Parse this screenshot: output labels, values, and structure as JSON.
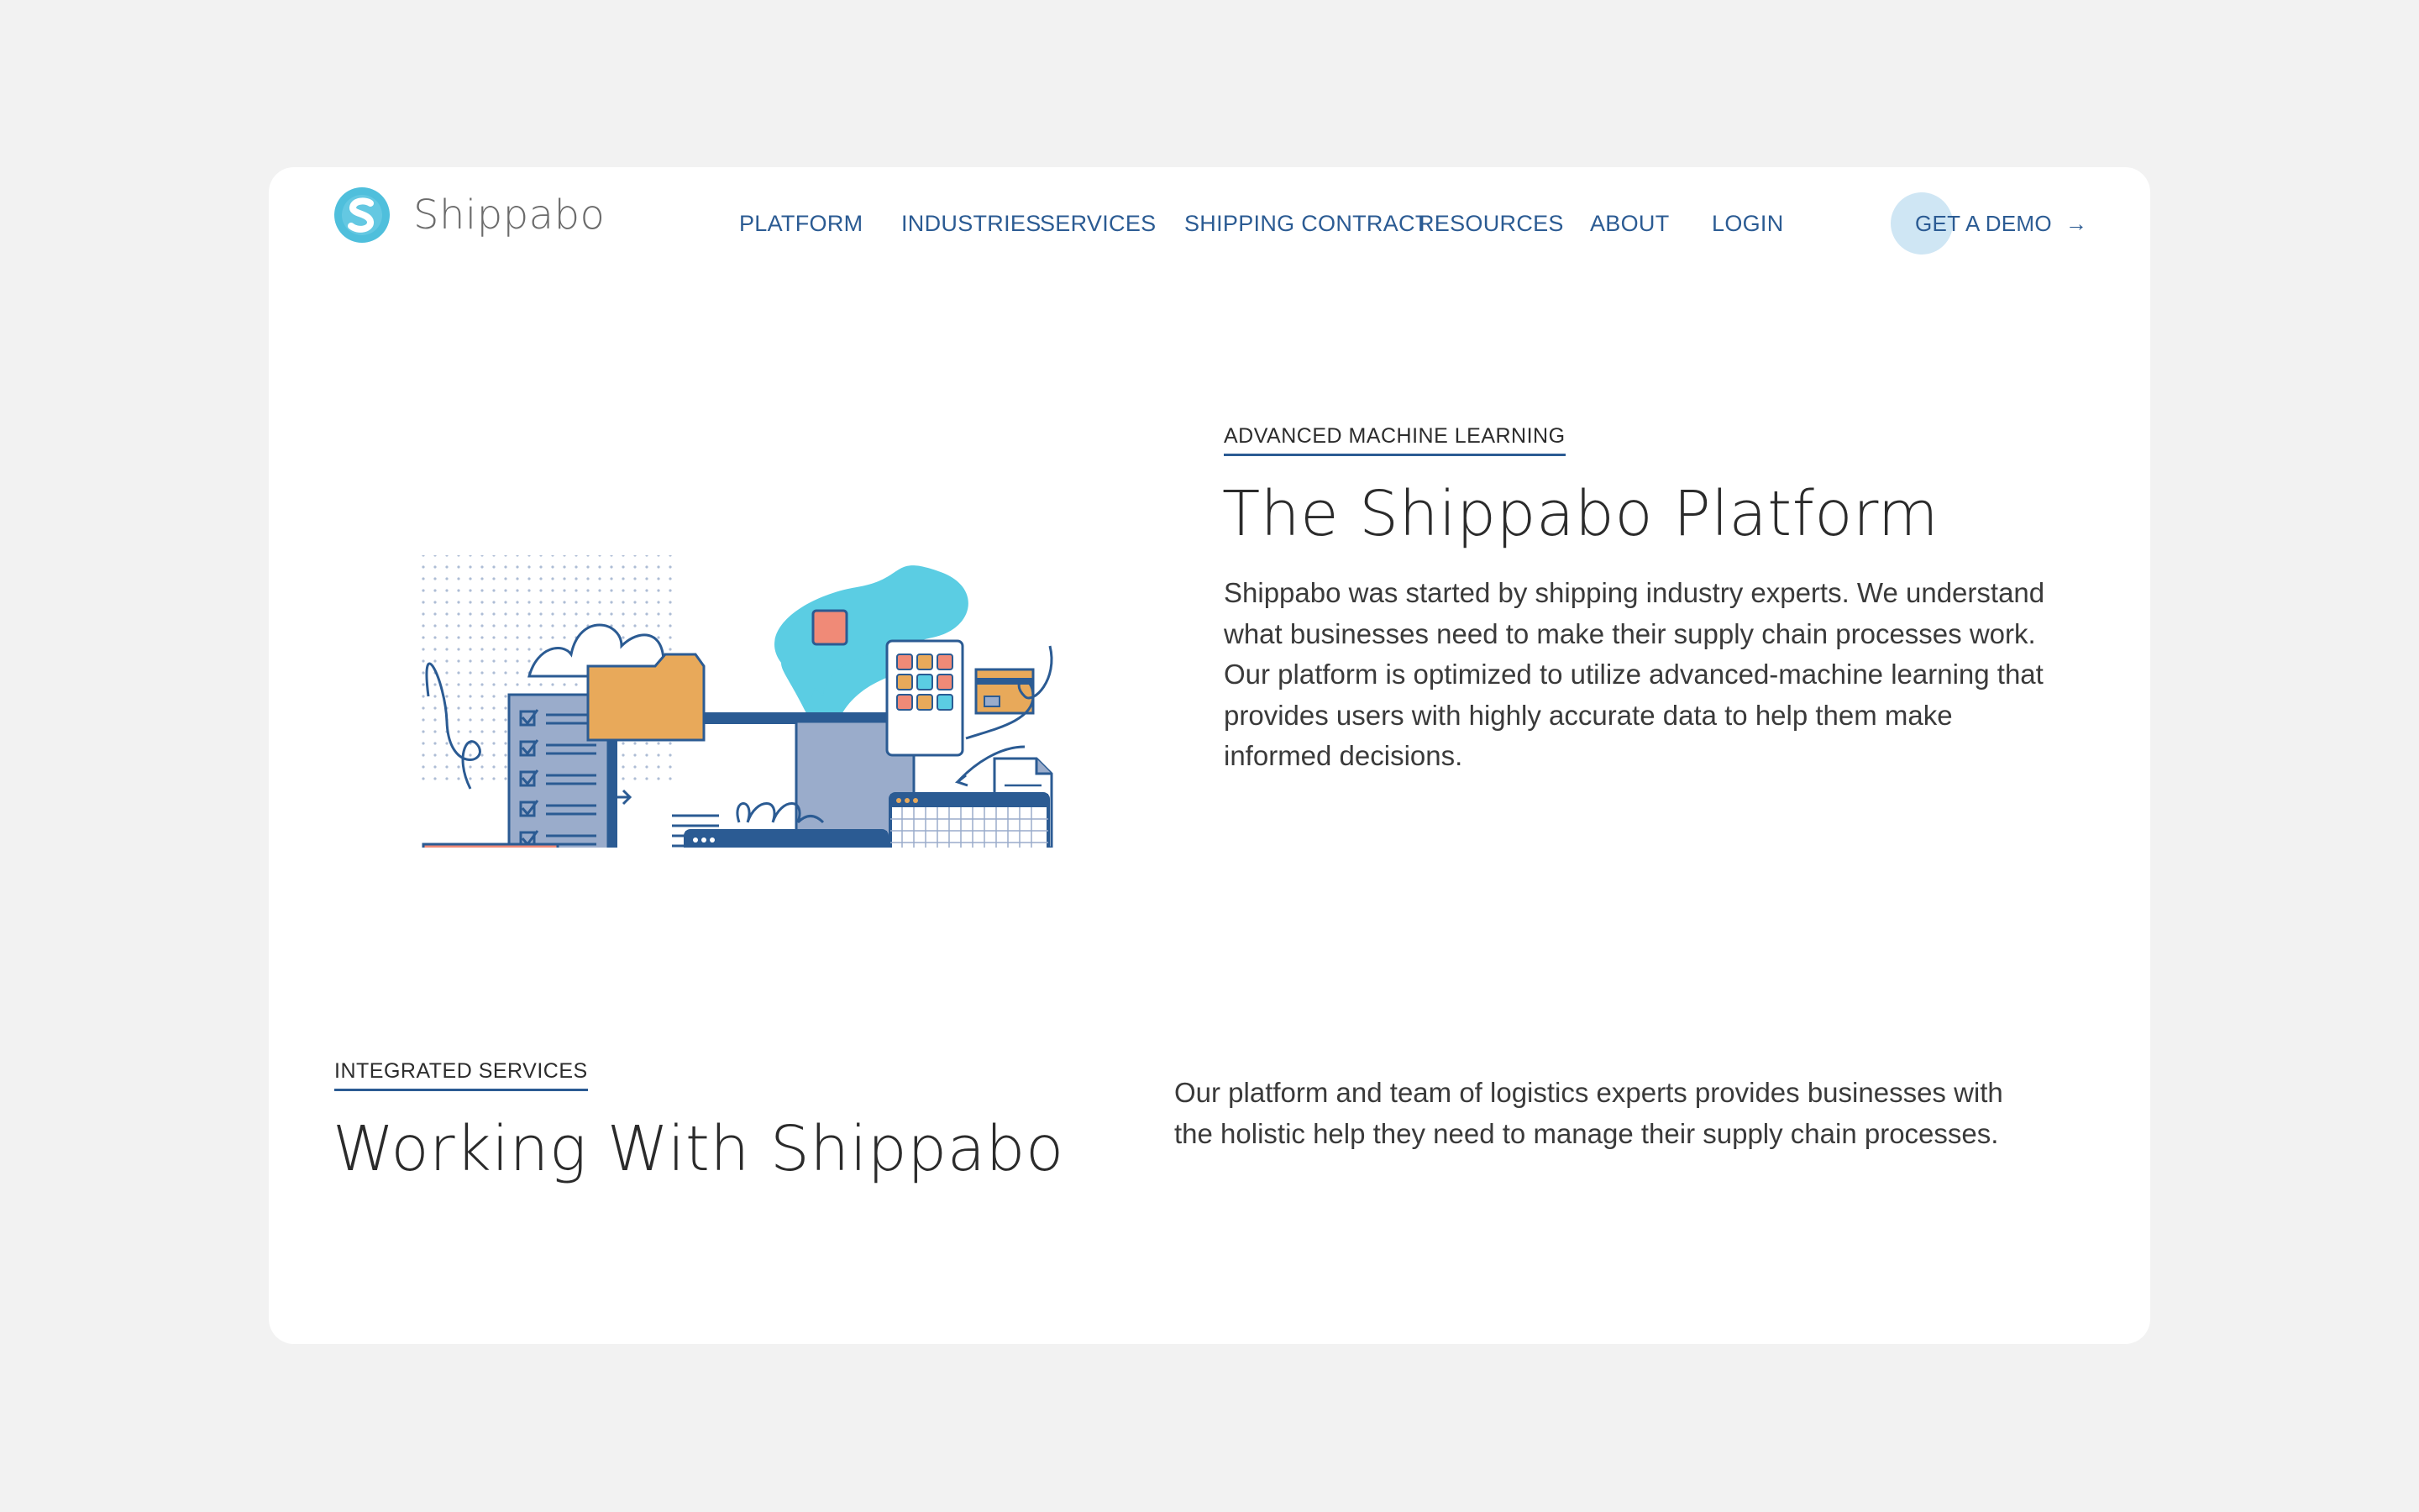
{
  "header": {
    "logo_text": "Shippabo",
    "nav": [
      {
        "label": "PLATFORM"
      },
      {
        "label": "INDUSTRIES"
      },
      {
        "label": "SERVICES"
      },
      {
        "label": "SHIPPING CONTRACT"
      },
      {
        "label": "RESOURCES"
      },
      {
        "label": "ABOUT"
      },
      {
        "label": "LOGIN"
      }
    ],
    "cta_label": "GET A DEMO",
    "cta_arrow": "→"
  },
  "hero": {
    "eyebrow": "ADVANCED MACHINE LEARNING",
    "title": "The Shippabo Platform",
    "text": "Shippabo was started by shipping industry experts. We understand what businesses need to make their supply chain processes work. Our platform is optimized to utilize advanced-machine learning that provides users with highly accurate data to help them make informed decisions."
  },
  "integrated": {
    "eyebrow": "INTEGRATED SERVICES",
    "title": "Working With Shippabo",
    "text": "Our platform and team of logistics experts provides businesses with the holistic help they need to manage their supply chain processes."
  },
  "colors": {
    "page_bg": "#f2f2f2",
    "card_bg": "#ffffff",
    "nav_blue": "#2b5b93",
    "logo_cyan": "#4fbfdc",
    "illus_navy": "#2b5b93",
    "illus_cyan": "#5bcde3",
    "illus_coral": "#f08a77",
    "illus_orange": "#e8a95a",
    "illus_slate": "#9aaccb"
  },
  "icons": {
    "logo": "shippabo-s-logo-icon",
    "illustration": "platform-illustration",
    "cta": "arrow-right-icon"
  }
}
